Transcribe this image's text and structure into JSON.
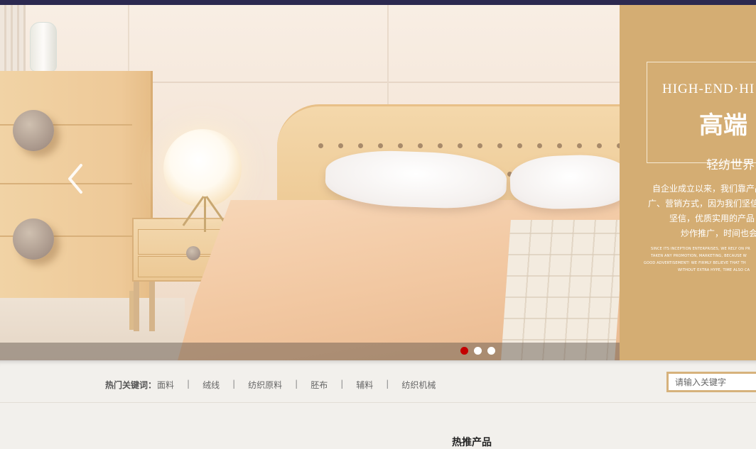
{
  "banner": {
    "prev_icon": "chevron-left-icon",
    "panel": {
      "en_title": "HIGH-END·HI",
      "cn_title": "高端",
      "subtitle": "轻纺世界",
      "lines": [
        "自企业成立以来，我们靠产品",
        "广、营销方式，因为我们坚信",
        "坚信，优质实用的产品",
        "炒作推广，时间也会"
      ],
      "small_lines": [
        "SINCE ITS INCEPTION ENTERPRISES, WE RELY ON PR",
        "TAKEN ANY PROMOTION, MARKETING, BECAUSE W",
        "GOOD ADVERTISEMENT! WE FIRMLY BELIEVE THAT TH",
        "WITHOUT EXTRA HYPE, TIME ALSO CA"
      ]
    },
    "pager": {
      "count": 3,
      "active": 0,
      "active_color": "#c40000",
      "inactive_color": "#ffffff"
    }
  },
  "keywords": {
    "label": "热门关键词：",
    "items": [
      "面料",
      "绒线",
      "纺织原料",
      "胚布",
      "辅料",
      "纺织机械"
    ],
    "separator": "|"
  },
  "search": {
    "placeholder": "请输入关键字"
  },
  "section": {
    "title": "热推产品"
  },
  "colors": {
    "topbar": "#2c2950",
    "gold": "#d4ad73",
    "search_border": "#d6b27c"
  }
}
